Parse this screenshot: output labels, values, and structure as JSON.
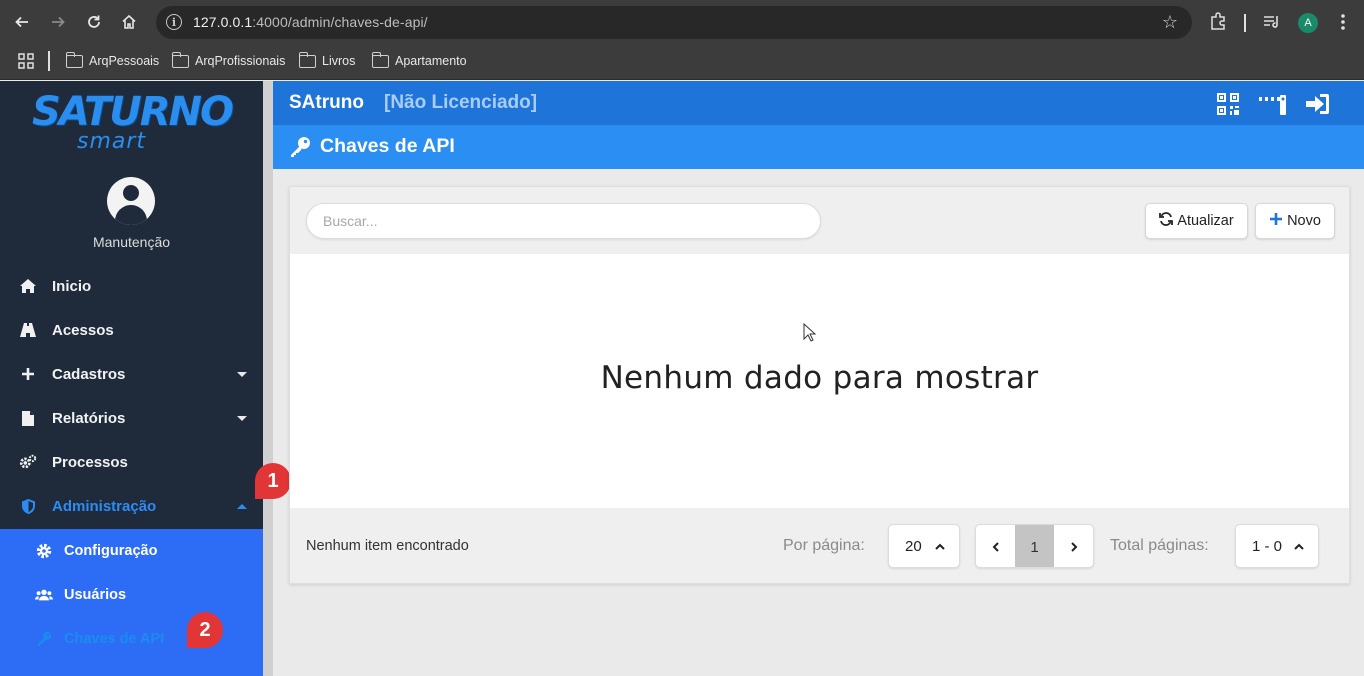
{
  "browser": {
    "url_host": "127.0.0.1",
    "url_rest": ":4000/admin/chaves-de-api/",
    "profile_initial": "A",
    "bookmarks": [
      "ArqPessoais",
      "ArqProfissionais",
      "Livros",
      "Apartamento"
    ]
  },
  "sidebar": {
    "logo_top": "SATURNO",
    "logo_bottom": "smart",
    "user_name": "Manutenção",
    "items": [
      {
        "label": "Inicio",
        "icon": "home-icon"
      },
      {
        "label": "Acessos",
        "icon": "road-icon"
      },
      {
        "label": "Cadastros",
        "icon": "plus-icon",
        "expandable": true
      },
      {
        "label": "Relatórios",
        "icon": "file-icon",
        "expandable": true
      },
      {
        "label": "Processos",
        "icon": "gears-icon"
      },
      {
        "label": "Administração",
        "icon": "shield-icon",
        "expanded": true
      }
    ],
    "subitems": [
      {
        "label": "Configuração",
        "icon": "gear-icon"
      },
      {
        "label": "Usuários",
        "icon": "users-icon"
      },
      {
        "label": "Chaves de API",
        "icon": "key-icon",
        "current": true
      }
    ],
    "annotations": [
      "1",
      "2"
    ]
  },
  "header": {
    "app_name": "SAtruno",
    "license_status": "[Não Licenciado]",
    "page_title": "Chaves de API"
  },
  "toolbar": {
    "search_placeholder": "Buscar...",
    "refresh_label": "Atualizar",
    "new_label": "Novo"
  },
  "table": {
    "empty_message": "Nenhum dado para mostrar"
  },
  "footer": {
    "items_text": "Nenhum item encontrado",
    "per_page_label": "Por página:",
    "per_page_value": "20",
    "current_page": "1",
    "total_pages_label": "Total páginas:",
    "total_pages_value": "1 - 0"
  },
  "colors": {
    "sidebar_bg": "#1f2b3b",
    "submenu_bg": "#2d6df6",
    "header_bg": "#1e74d9",
    "page_header_bg": "#2a8ef2",
    "badge": "#e23535"
  }
}
